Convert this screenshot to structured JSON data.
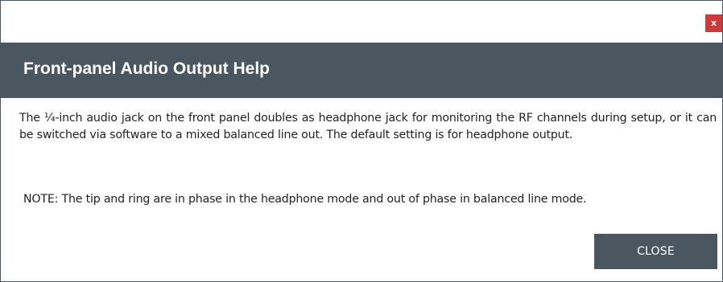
{
  "dialog": {
    "close_x_label": "x",
    "title": "Front-panel Audio Output Help",
    "body_text": "The ¼-inch audio jack on the front panel doubles as headphone jack for monitoring the RF channels during setup, or it can be switched via software to a mixed balanced line out. The default setting is for headphone output.",
    "note_text": "NOTE: The tip and ring are in phase in the headphone mode and out of phase in balanced line mode.",
    "close_button_label": "CLOSE"
  },
  "colors": {
    "header_bg": "#4a5761",
    "close_x_bg": "#cc3b3b",
    "button_bg": "#4a5761"
  }
}
